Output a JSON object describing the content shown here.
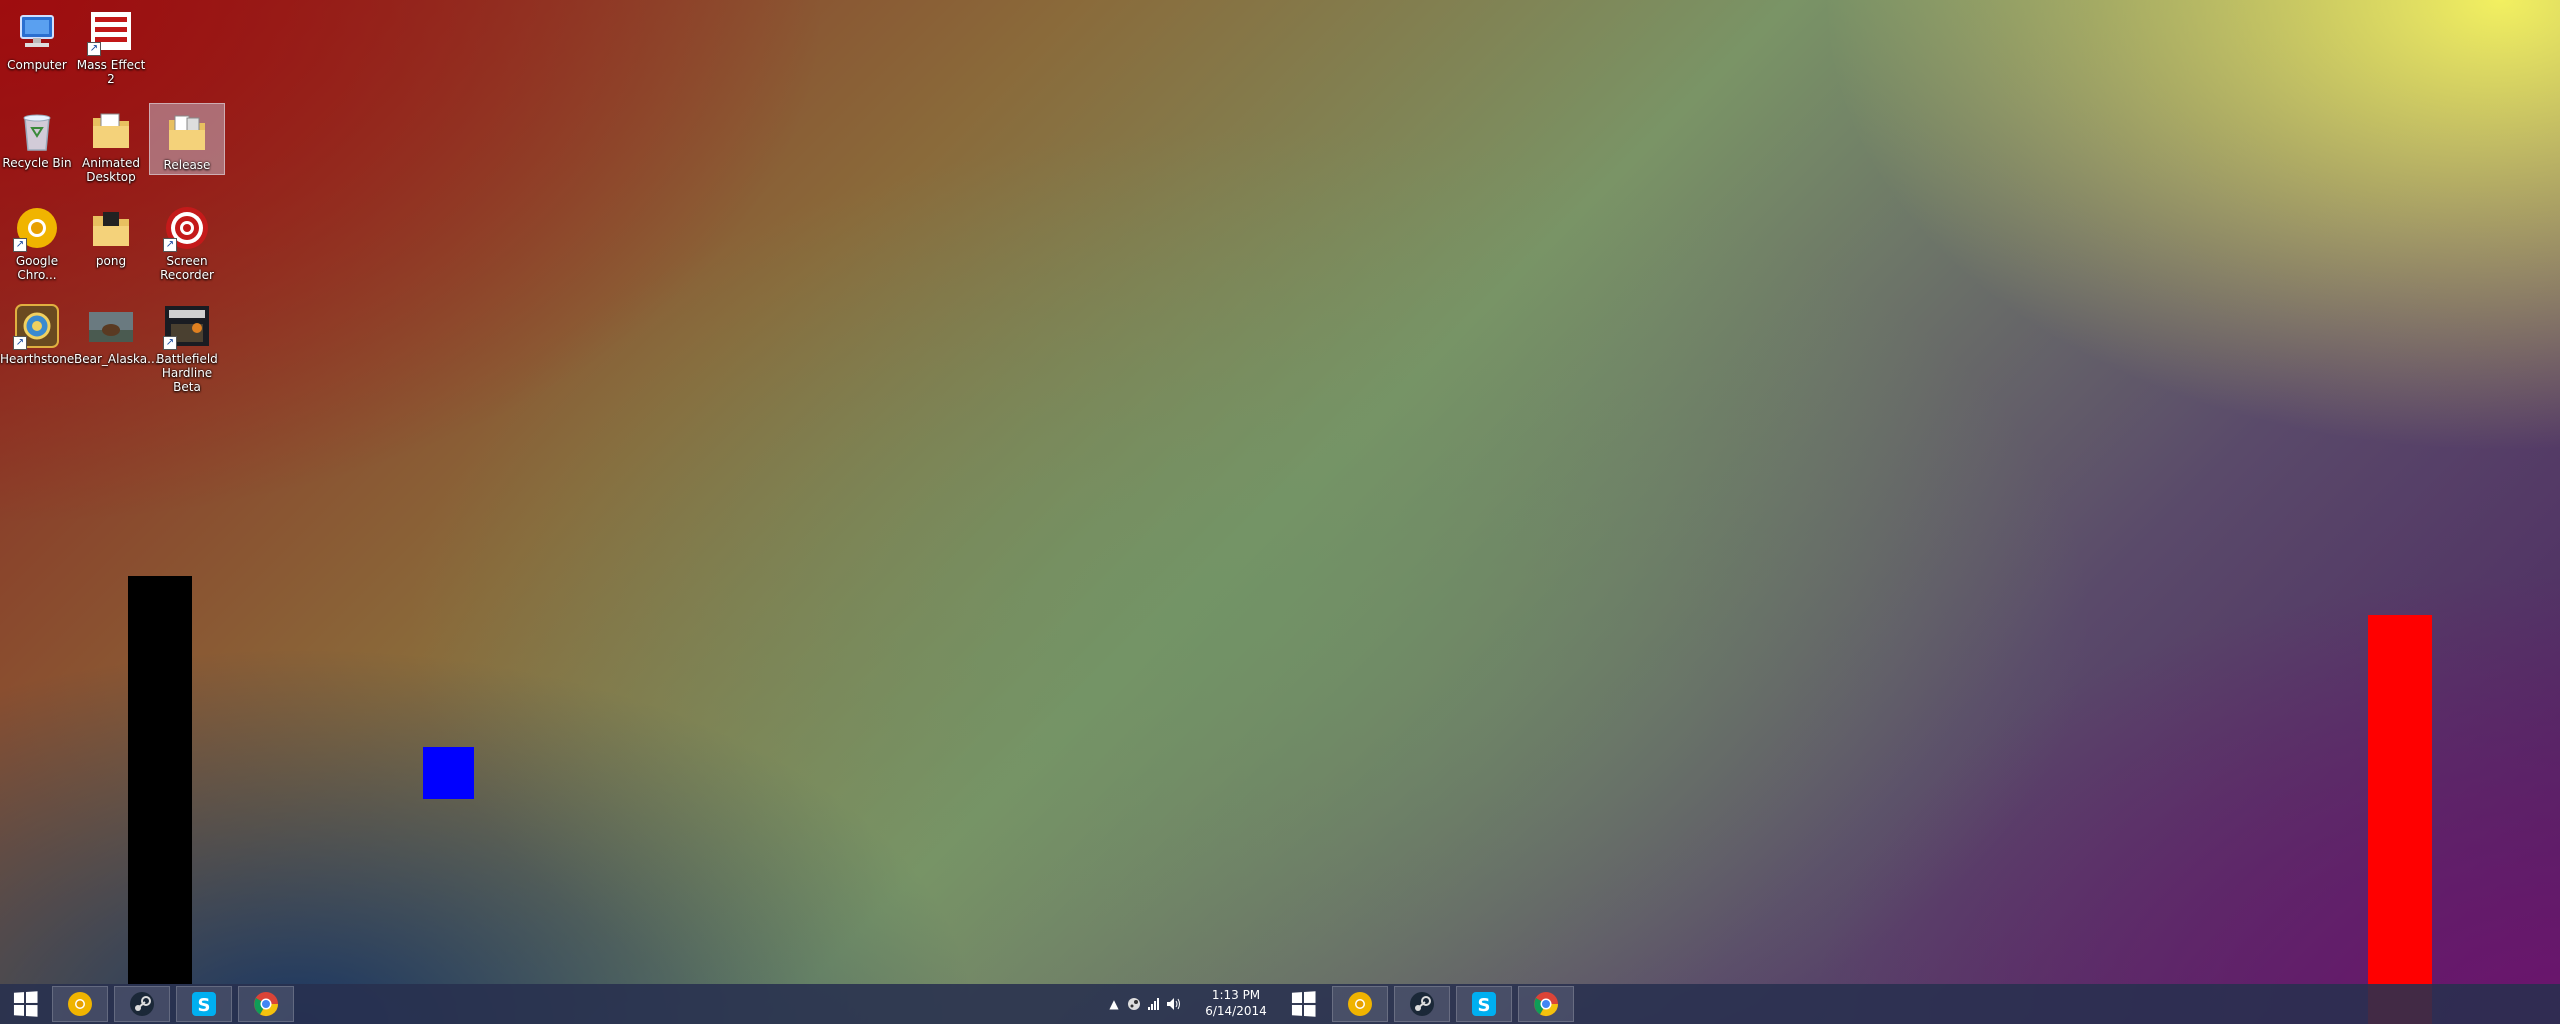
{
  "desktop": {
    "icons": [
      {
        "label": "Computer",
        "icon": "computer-icon"
      },
      {
        "label": "Mass Effect 2",
        "icon": "mass-effect-2-icon"
      },
      {
        "label": "Recycle Bin",
        "icon": "recycle-bin-icon"
      },
      {
        "label": "Animated Desktop",
        "icon": "folder-icon"
      },
      {
        "label": "Release",
        "icon": "folder-icon",
        "selected": true
      },
      {
        "label": "Google Chro...",
        "icon": "google-chrome-canary-icon"
      },
      {
        "label": "pong",
        "icon": "folder-icon"
      },
      {
        "label": "Screen Recorder",
        "icon": "screen-recorder-icon"
      },
      {
        "label": "Hearthstone",
        "icon": "hearthstone-icon"
      },
      {
        "label": "Bear_Alaska...",
        "icon": "image-thumbnail-icon"
      },
      {
        "label": "Battlefield Hardline Beta",
        "icon": "battlefield-hardline-icon"
      }
    ]
  },
  "game": {
    "left_paddle_color": "#000000",
    "right_paddle_color": "#ff0000",
    "ball_color": "#0000ff"
  },
  "taskbar": {
    "left_apps": [
      "chrome-canary-icon",
      "steam-icon",
      "skype-icon",
      "chrome-icon"
    ],
    "right_apps": [
      "chrome-canary-icon",
      "steam-icon",
      "skype-icon",
      "chrome-icon"
    ],
    "clock": {
      "time": "1:13 PM",
      "date": "6/14/2014"
    },
    "tray_icons": [
      "show-hidden-icons-chevron",
      "steam-tray-icon",
      "network-signal-icon",
      "volume-icon"
    ]
  }
}
